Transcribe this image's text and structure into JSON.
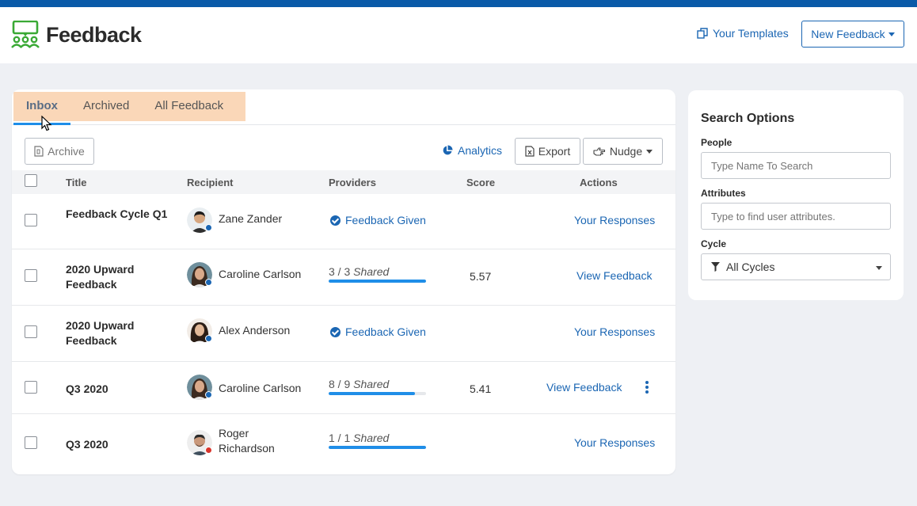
{
  "app": {
    "brand": "Feedback",
    "templates_link": "Your Templates",
    "new_feedback_button": "New Feedback",
    "accent_color": "#1b66b3",
    "topbar_color": "#0a5aa8"
  },
  "tabs": [
    {
      "label": "Inbox",
      "active": true
    },
    {
      "label": "Archived",
      "active": false
    },
    {
      "label": "All Feedback",
      "active": false
    }
  ],
  "toolbar": {
    "archive_label": "Archive",
    "analytics_label": "Analytics",
    "export_label": "Export",
    "nudge_label": "Nudge"
  },
  "table": {
    "headers": {
      "title": "Title",
      "recipient": "Recipient",
      "providers": "Providers",
      "score": "Score",
      "actions": "Actions"
    },
    "rows": [
      {
        "title": "Feedback Cycle Q1",
        "recipient": "Zane Zander",
        "providers": {
          "type": "given",
          "label": "Feedback Given"
        },
        "score": "",
        "action": "Your Responses",
        "status_color": "#1b66b3"
      },
      {
        "title": "2020 Upward Feedback",
        "recipient": "Caroline Carlson",
        "providers": {
          "type": "shared",
          "count": "3 / 3",
          "label": "Shared",
          "fraction": 1.0
        },
        "score": "5.57",
        "action": "View Feedback",
        "status_color": "#1b66b3"
      },
      {
        "title": "2020 Upward Feedback",
        "recipient": "Alex Anderson",
        "providers": {
          "type": "given",
          "label": "Feedback Given"
        },
        "score": "",
        "action": "Your Responses",
        "status_color": "#1b66b3"
      },
      {
        "title": "Q3 2020",
        "recipient": "Caroline Carlson",
        "providers": {
          "type": "shared",
          "count": "8 / 9",
          "label": "Shared",
          "fraction": 0.889
        },
        "score": "5.41",
        "action": "View Feedback",
        "status_color": "#1b66b3"
      },
      {
        "title": "Q3 2020",
        "recipient": "Roger Richardson",
        "providers": {
          "type": "shared",
          "count": "1 / 1",
          "label": "Shared",
          "fraction": 1.0
        },
        "score": "",
        "action": "Your Responses",
        "status_color": "#d9342b"
      }
    ]
  },
  "search": {
    "title": "Search Options",
    "people_label": "People",
    "people_placeholder": "Type Name To Search",
    "attributes_label": "Attributes",
    "attributes_placeholder": "Type to find user attributes.",
    "cycle_label": "Cycle",
    "cycle_value": "All Cycles"
  }
}
